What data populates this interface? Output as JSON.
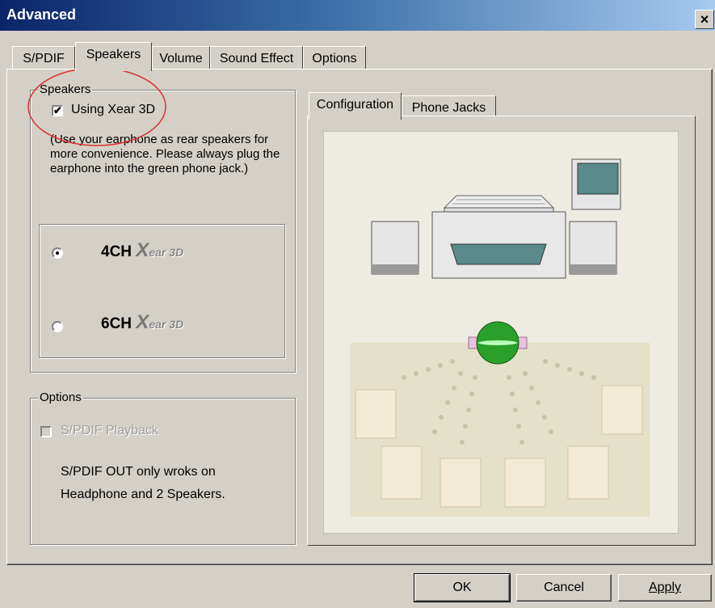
{
  "window": {
    "title": "Advanced",
    "close_glyph": "×"
  },
  "tabs": [
    {
      "label": "S/PDIF"
    },
    {
      "label": "Speakers",
      "selected": true
    },
    {
      "label": "Volume"
    },
    {
      "label": "Sound Effect"
    },
    {
      "label": "Options"
    }
  ],
  "speakers_group": {
    "legend": "Speakers",
    "checkbox_label": "Using Xear 3D",
    "checked": true,
    "description": "(Use your earphone as rear speakers for more convenience. Please always plug the earphone into the green phone jack.)",
    "modes": [
      {
        "label": "4CH",
        "brand": "ear 3D",
        "selected": true
      },
      {
        "label": "6CH",
        "brand": "ear 3D",
        "selected": false
      }
    ],
    "brand_x": "X"
  },
  "options_group": {
    "legend": "Options",
    "checkbox_label": "S/PDIF Playback",
    "enabled": false,
    "note": "S/PDIF OUT only wroks on Headphone and 2 Speakers."
  },
  "right_tabs": [
    {
      "label": "Configuration",
      "selected": true
    },
    {
      "label": "Phone Jacks"
    }
  ],
  "buttons": {
    "ok": "OK",
    "cancel": "Cancel",
    "apply": "Apply"
  },
  "colors": {
    "titlebar": "#0a246a",
    "annotation_circle": "#e03030",
    "sphere": "#2aa02a"
  }
}
